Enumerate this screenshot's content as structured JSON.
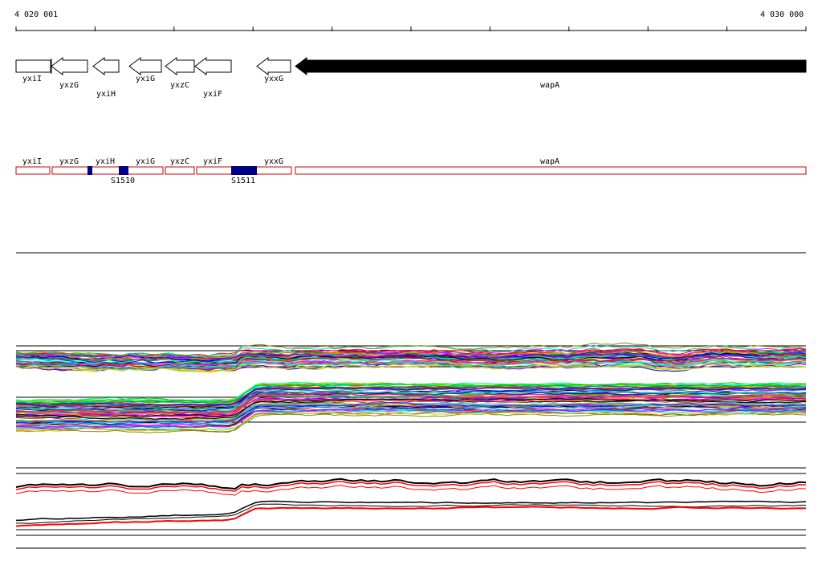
{
  "ruler": {
    "start_label": "4 020 001",
    "end_label": "4 030 000",
    "color": "#000000"
  },
  "genes": [
    {
      "name": "yxiI",
      "strand": "plus-box",
      "filled": false
    },
    {
      "name": "yxzG",
      "strand": "minus",
      "filled": false
    },
    {
      "name": "yxiH",
      "strand": "minus",
      "filled": false
    },
    {
      "name": "yxiG",
      "strand": "minus",
      "filled": false
    },
    {
      "name": "yxzC",
      "strand": "minus",
      "filled": false
    },
    {
      "name": "yxiF",
      "strand": "minus",
      "filled": false
    },
    {
      "name": "yxxG",
      "strand": "minus",
      "filled": false
    },
    {
      "name": "wapA",
      "strand": "minus",
      "filled": true
    }
  ],
  "features": [
    {
      "name": "S1510"
    },
    {
      "name": "S1511"
    }
  ],
  "colors": {
    "feature_box": "#cc0000",
    "feature_block": "#000080",
    "gene_outline": "#000000",
    "signal_black": "#000000",
    "signal_red": "#ff0000"
  },
  "tracks": {
    "profile_palette": [
      "#ff00ff",
      "#00cc00",
      "#0000ff",
      "#ff0000",
      "#00cccc",
      "#cccc00",
      "#ff8800",
      "#8800ff",
      "#008888",
      "#888800",
      "#ff0088",
      "#00ff88",
      "#4444ff",
      "#884400",
      "#000000",
      "#00ffff"
    ]
  }
}
